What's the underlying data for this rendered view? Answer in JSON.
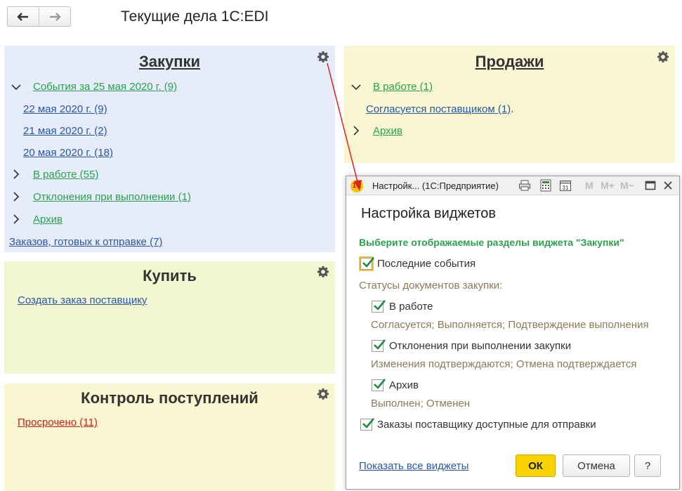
{
  "page": {
    "title": "Текущие дела 1С:EDI"
  },
  "nav": {
    "back_icon": "arrow-left-icon",
    "forward_icon": "arrow-right-icon"
  },
  "zakupki": {
    "title": "Закупки",
    "events": "События за 25 мая 2020 г. (9)",
    "days": [
      "22 мая 2020 г. (9)",
      "21 мая 2020 г. (2)",
      "20 мая 2020 г. (18)"
    ],
    "in_work": "В работе (55)",
    "deviations": "Отклонения при выполнении (1)",
    "archive": "Архив",
    "ready": "Заказов, готовых к отправке (7)"
  },
  "prodazhi": {
    "title": "Продажи",
    "in_work": "В работе (1)",
    "agreed": "Согласуется поставщиком (1)",
    "dot": ".",
    "archive": "Архив"
  },
  "kupit": {
    "title": "Купить",
    "create": "Создать заказ поставщику"
  },
  "kontrol": {
    "title": "Контроль поступлений",
    "overdue": "Просрочено (11)"
  },
  "dialog": {
    "window_title": "Настройк... (1С:Предприятие)",
    "logo": "1С",
    "m_buttons": [
      "M",
      "M+",
      "M−"
    ],
    "heading": "Настройка виджетов",
    "subtitle": "Выберите отображаемые разделы виджета \"Закупки\"",
    "last_events": "Последние события",
    "statuses_label": "Статусы документов закупки:",
    "in_work": "В работе",
    "in_work_hint": "Согласуется; Выполняется; Подтверждение выполнения",
    "deviations": "Отклонения при выполнении закупки",
    "deviations_hint": "Изменения подтверждаются; Отмена подтверждается",
    "archive": "Архив",
    "archive_hint": "Выполнен; Отменен",
    "orders_ready": "Заказы поставщику доступные для отправки",
    "show_all": "Показать все виджеты",
    "ok": "ОК",
    "cancel": "Отмена",
    "help": "?"
  },
  "colors": {
    "link_green": "#2aa14d",
    "link_blue": "#2a57a8",
    "link_red": "#d21b1b",
    "ok_yellow": "#f9d400",
    "arrow_red": "#e02020"
  }
}
